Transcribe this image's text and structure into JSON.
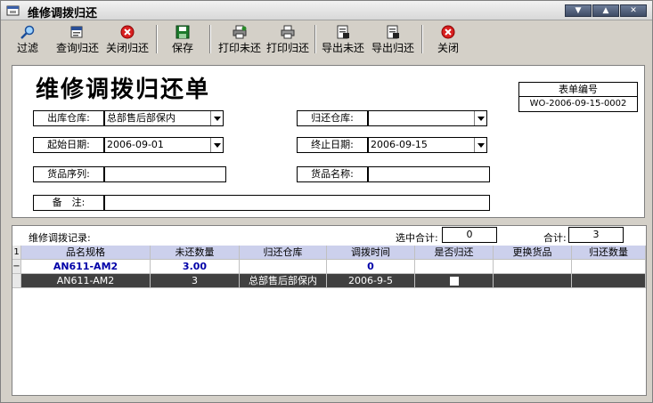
{
  "window": {
    "title": "维修调拨归还",
    "buttons": [
      "▼",
      "▲",
      "✕"
    ]
  },
  "toolbar": {
    "filter": "过滤",
    "query_return": "查询归还",
    "close_return": "关闭归还",
    "save": "保存",
    "print_unreturned": "打印未还",
    "print_return": "打印归还",
    "export_unreturned": "导出未还",
    "export_return": "导出归还",
    "close": "关闭"
  },
  "form": {
    "title": "维修调拨归还单",
    "doc_number_label": "表单编号",
    "doc_number": "WO-2006-09-15-0002",
    "out_warehouse_label": "出库仓库:",
    "out_warehouse": "总部售后部保内",
    "return_warehouse_label": "归还仓库:",
    "return_warehouse": "",
    "start_date_label": "起始日期:",
    "start_date": "2006-09-01",
    "end_date_label": "终止日期:",
    "end_date": "2006-09-15",
    "serial_label": "货品序列:",
    "serial": "",
    "product_name_label": "货品名称:",
    "product_name": "",
    "remark_label": "备　注:",
    "remark": ""
  },
  "records": {
    "label": "维修调拨记录:",
    "selected_total_label": "选中合计:",
    "selected_total": "0",
    "total_label": "合计:",
    "total": "3"
  },
  "grid": {
    "row_header": "1",
    "columns": [
      "品名规格",
      "未还数量",
      "归还仓库",
      "调拨时间",
      "是否归还",
      "更换货品",
      "归还数量"
    ],
    "summary_row": {
      "marker": "−",
      "spec": "AN611-AM2",
      "unreturned": "3.00",
      "return_wh": "",
      "time": "0",
      "returned": "",
      "replacement": "",
      "return_qty": ""
    },
    "detail_row": {
      "spec": "AN611-AM2",
      "unreturned": "3",
      "return_wh": "总部售后部保内",
      "time": "2006-9-5",
      "returned": false,
      "replacement": "",
      "return_qty": ""
    }
  }
}
